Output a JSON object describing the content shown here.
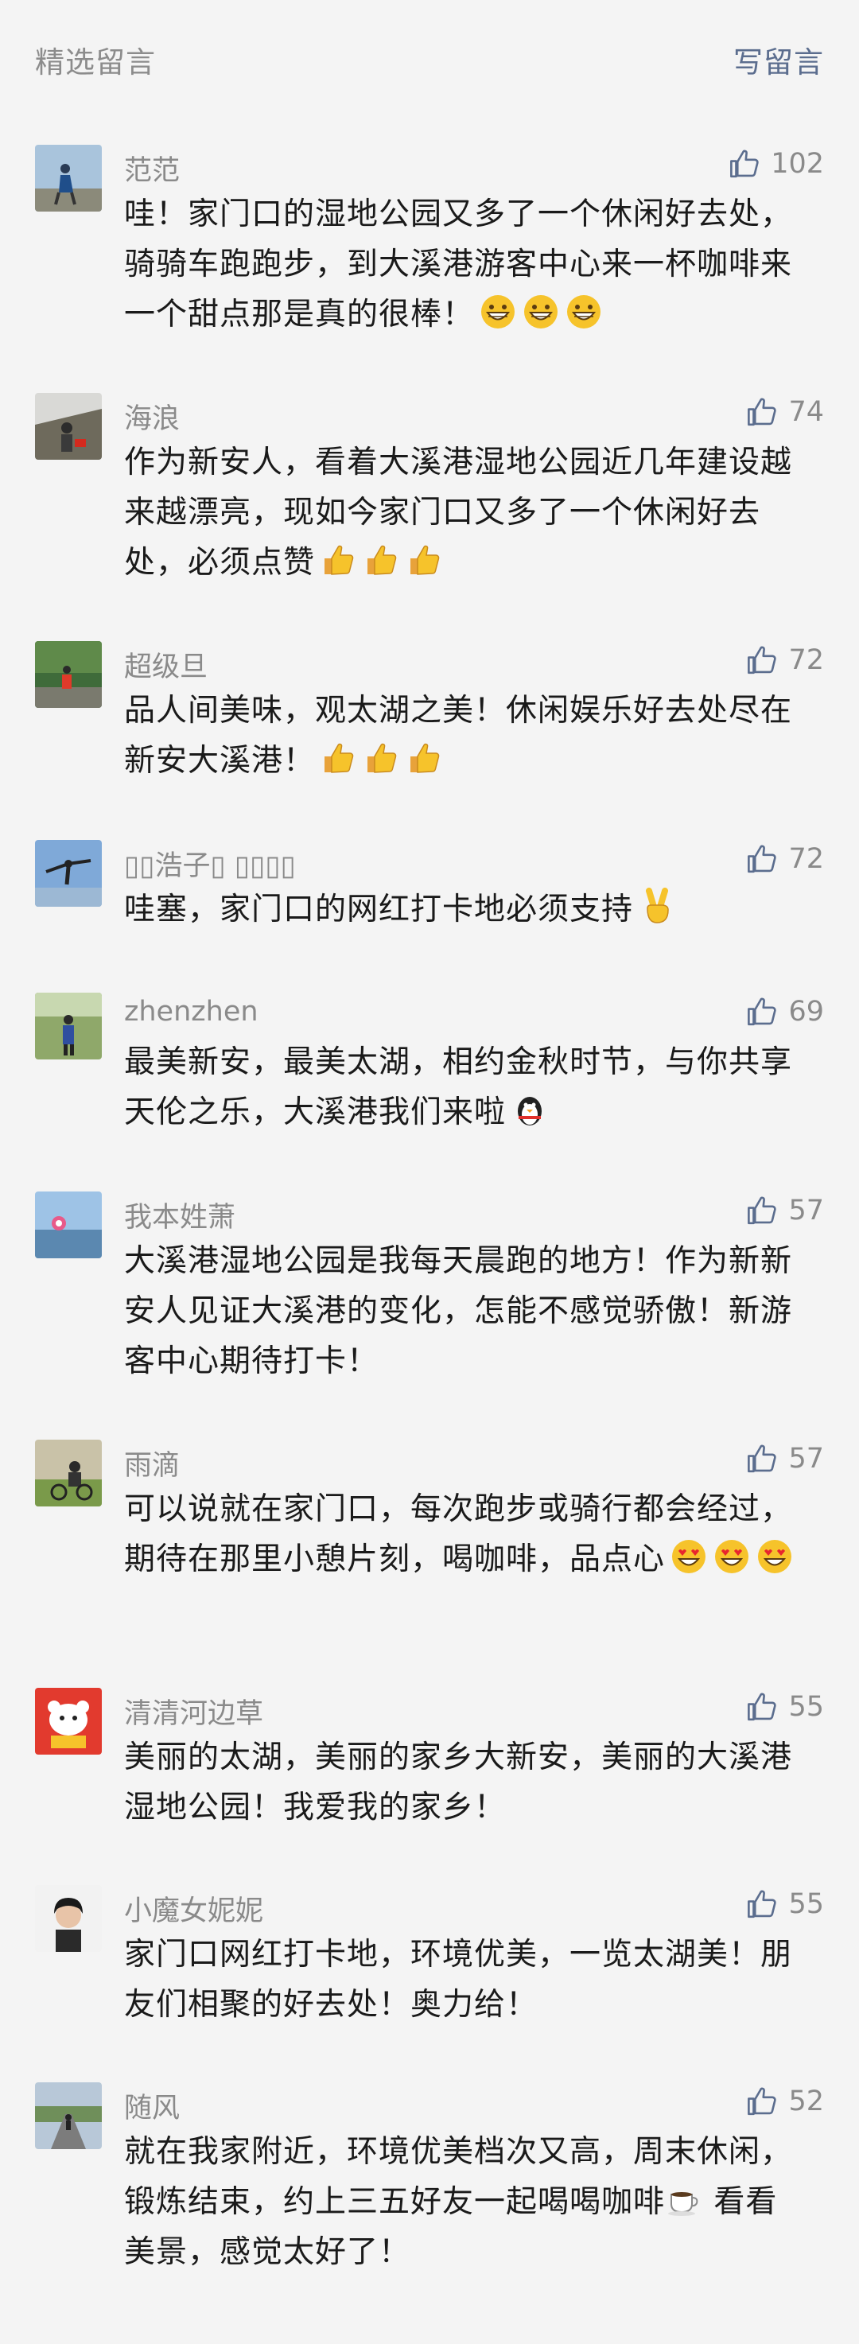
{
  "header": {
    "title": "精选留言",
    "write_label": "写留言"
  },
  "like_icon": "thumbs-up-icon",
  "comments": [
    {
      "nickname": "范范",
      "likes": "102",
      "text": "哇！家门口的湿地公园又多了一个休闲好去处，骑骑车跑跑步，到大溪港游客中心来一杯咖啡来一个甜点那是真的很棒！",
      "emoji": [
        "grinning-face-emoji",
        "grinning-face-emoji",
        "grinning-face-emoji"
      ]
    },
    {
      "nickname": "海浪",
      "likes": "74",
      "text": "作为新安人，看着大溪港湿地公园近几年建设越来越漂亮，现如今家门口又多了一个休闲好去处，必须点赞",
      "emoji": [
        "thumbs-up-emoji",
        "thumbs-up-emoji",
        "thumbs-up-emoji"
      ]
    },
    {
      "nickname": "超级旦",
      "likes": "72",
      "text": "品人间美味，观太湖之美！休闲娱乐好去处尽在新安大溪港！",
      "emoji": [
        "thumbs-up-emoji",
        "thumbs-up-emoji",
        "thumbs-up-emoji"
      ]
    },
    {
      "nickname": "▯▯浩子▯ ▯▯▯▯",
      "likes": "72",
      "text": "哇塞，家门口的网红打卡地必须支持",
      "emoji": [
        "victory-hand-emoji"
      ]
    },
    {
      "nickname": "zhenzhen",
      "likes": "69",
      "text": "最美新安，最美太湖，相约金秋时节，与你共享天伦之乐，大溪港我们来啦",
      "emoji": [
        "penguin-emoji"
      ]
    },
    {
      "nickname": "我本姓萧",
      "likes": "57",
      "text": "大溪港湿地公园是我每天晨跑的地方！作为新新安人见证大溪港的变化，怎能不感觉骄傲！新游客中心期待打卡！",
      "emoji": []
    },
    {
      "nickname": "雨滴",
      "likes": "57",
      "text": "可以说就在家门口，每次跑步或骑行都会经过，期待在那里小憩片刻，喝咖啡，品点心",
      "emoji": [
        "heart-eyes-emoji",
        "heart-eyes-emoji",
        "heart-eyes-emoji"
      ]
    },
    {
      "nickname": "清清河边草",
      "likes": "55",
      "text": "美丽的太湖，美丽的家乡大新安，美丽的大溪港湿地公园！我爱我的家乡！",
      "emoji": []
    },
    {
      "nickname": "小魔女妮妮",
      "likes": "55",
      "text": "家门口网红打卡地，环境优美，一览太湖美！朋友们相聚的好去处！奥力给！",
      "emoji": []
    },
    {
      "nickname": "随风",
      "likes": "52",
      "text_before": "就在我家附近，环境优美档次又高，周末休闲，锻炼结束，约上三五好友一起喝喝咖啡",
      "text_after": " 看看美景，感觉太好了！",
      "emoji": [
        "coffee-emoji"
      ]
    }
  ]
}
